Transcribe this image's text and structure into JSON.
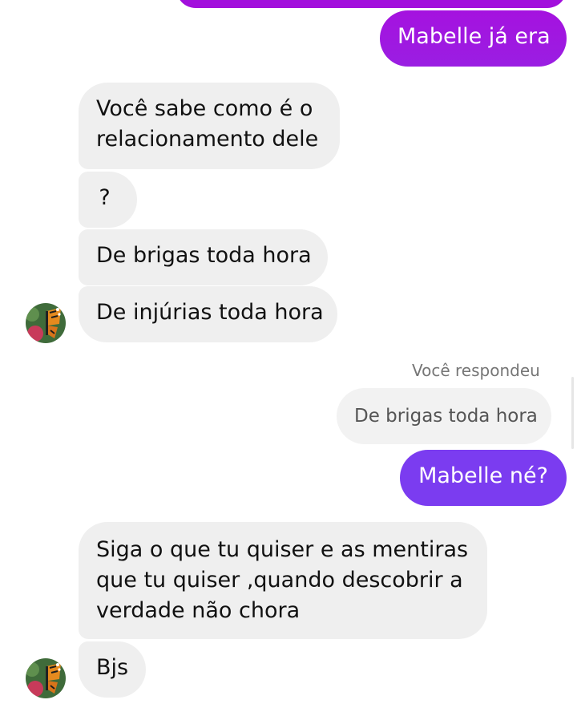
{
  "colors": {
    "outgoing_gradient_top": "#a512df",
    "outgoing_gradient_bottom": "#7a32e8",
    "outgoing_violet": "#7b3cf0",
    "incoming_bg": "#efefef"
  },
  "messages": [
    {
      "id": "m1",
      "side": "outgoing",
      "text": "Mabelle já era"
    },
    {
      "id": "m2",
      "side": "incoming",
      "lines": [
        "Você sabe como é o",
        "relacionamento dele"
      ]
    },
    {
      "id": "m3",
      "side": "incoming",
      "text": "?"
    },
    {
      "id": "m4",
      "side": "incoming",
      "text": "De brigas toda hora"
    },
    {
      "id": "m5",
      "side": "incoming",
      "text": "De injúrias toda hora"
    },
    {
      "id": "m6",
      "side": "outgoing",
      "reply_label": "Você respondeu",
      "quoted_text": "De brigas toda hora",
      "text": "Mabelle né?"
    },
    {
      "id": "m7",
      "side": "incoming",
      "lines": [
        "Siga o que tu quiser e as mentiras",
        "que tu quiser ,quando descobrir a",
        "verdade não chora"
      ]
    },
    {
      "id": "m8",
      "side": "incoming",
      "text": "Bjs"
    }
  ],
  "avatar": {
    "icon": "butterfly-avatar-icon"
  }
}
